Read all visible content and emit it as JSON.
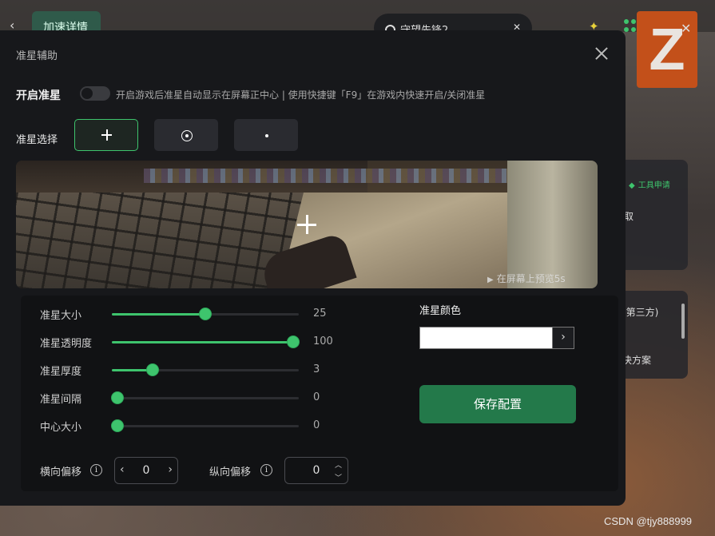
{
  "background": {
    "tab_label": "加速详情",
    "search_text": "守望先锋2",
    "card1": {
      "tool_label": "工具申请",
      "text": "取"
    },
    "card2": {
      "text1": "(第三方)",
      "text2": "决方案"
    },
    "watermark": "CSDN @tjy888999"
  },
  "dialog": {
    "title": "准星辅助",
    "enable_label": "开启准星",
    "enable_hint": "开启游戏后准星自动显示在屏幕正中心 | 使用快捷键「F9」在游戏内快速开启/关闭准星",
    "enabled": false,
    "select_label": "准星选择",
    "crosshair_options": [
      {
        "icon": "cross-icon",
        "selected": true
      },
      {
        "icon": "circle-dot-icon",
        "selected": false
      },
      {
        "icon": "dot-icon",
        "selected": false
      }
    ],
    "preview_hint": "在屏幕上预览5s",
    "sliders": [
      {
        "label": "准星大小",
        "value": "25",
        "fraction": 0.5
      },
      {
        "label": "准星透明度",
        "value": "100",
        "fraction": 0.97
      },
      {
        "label": "准星厚度",
        "value": "3",
        "fraction": 0.22
      },
      {
        "label": "准星间隔",
        "value": "0",
        "fraction": 0.03
      },
      {
        "label": "中心大小",
        "value": "0",
        "fraction": 0.03
      }
    ],
    "color_label": "准星颜色",
    "color_value": "#ffffff",
    "save_label": "保存配置",
    "h_offset": {
      "label": "横向偏移",
      "value": "0"
    },
    "v_offset": {
      "label": "纵向偏移",
      "value": "0"
    }
  },
  "colors": {
    "accent": "#3ec46d",
    "button": "#23794a",
    "panel": "#17181b"
  }
}
